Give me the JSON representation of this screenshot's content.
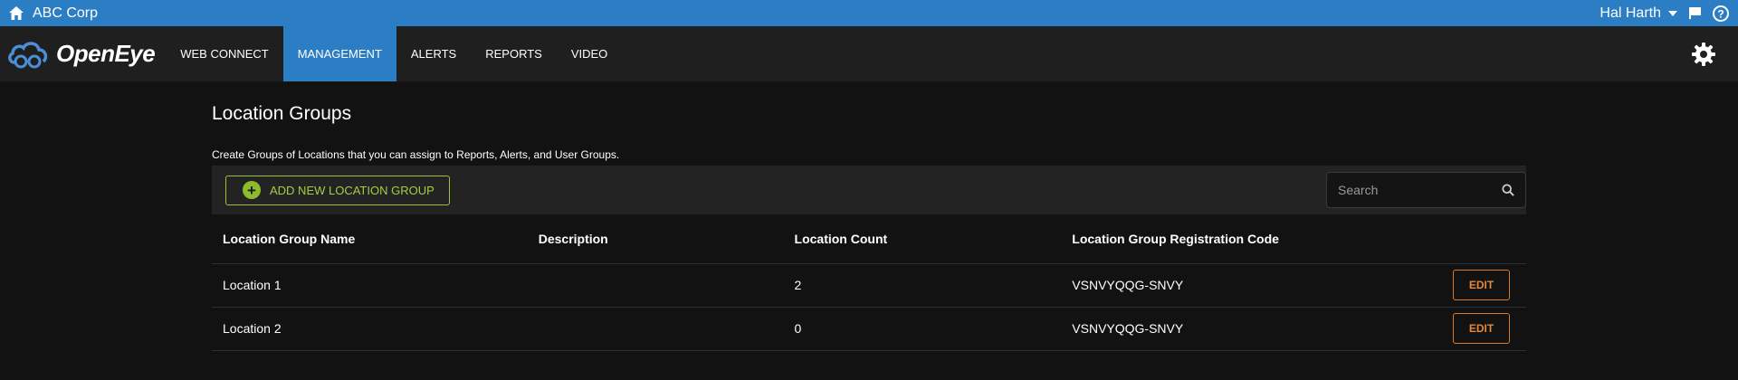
{
  "topbar": {
    "company": "ABC Corp",
    "user": "Hal Harth",
    "color": "#2c7ec4"
  },
  "navbar": {
    "logo_text": "OpenEye",
    "items": [
      {
        "label": "WEB CONNECT",
        "active": false
      },
      {
        "label": "MANAGEMENT",
        "active": true
      },
      {
        "label": "ALERTS",
        "active": false
      },
      {
        "label": "REPORTS",
        "active": false
      },
      {
        "label": "VIDEO",
        "active": false
      }
    ]
  },
  "page": {
    "title": "Location Groups",
    "description": "Create Groups of Locations that you can assign to Reports, Alerts, and User Groups."
  },
  "toolbar": {
    "add_label": "ADD NEW LOCATION GROUP",
    "search_placeholder": "Search"
  },
  "table": {
    "columns": [
      "Location Group Name",
      "Description",
      "Location Count",
      "Location Group Registration Code",
      ""
    ],
    "rows": [
      {
        "name": "Location 1",
        "description": "",
        "count": "2",
        "code": "VSNVYQQG-SNVY",
        "action": "EDIT"
      },
      {
        "name": "Location 2",
        "description": "",
        "count": "0",
        "code": "VSNVYQQG-SNVY",
        "action": "EDIT"
      }
    ]
  },
  "colors": {
    "accent": "#2c7ec4",
    "add_green": "#9ac33c",
    "edit_orange": "#d97a2b",
    "background": "#121212"
  }
}
